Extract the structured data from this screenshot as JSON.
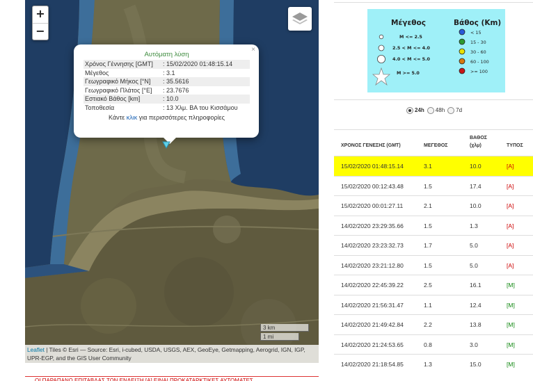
{
  "map": {
    "zoom_in": "+",
    "zoom_out": "−",
    "popup": {
      "title": "Αυτόματη λύση",
      "close": "×",
      "rows": [
        {
          "key": "Χρόνος Γέννησης [GMT]",
          "value": ": 15/02/2020 01:48:15.14"
        },
        {
          "key": "Μέγεθος",
          "value": ": 3.1"
        },
        {
          "key": "Γεωγραφικό Μήκος [°N]",
          "value": ": 35.5616"
        },
        {
          "key": "Γεωγραφικό Πλάτος [°E]",
          "value": ": 23.7676"
        },
        {
          "key": "Εστιακό Βάθος [km]",
          "value": ": 10.0"
        },
        {
          "key": "Τοποθεσία",
          "value": ": 13 Χλμ. ΒΑ του Κισσάμου"
        }
      ],
      "more_pre": "Κάντε ",
      "more_link": "κλικ",
      "more_post": " για περισσότερες πληροφορίες"
    },
    "scale": {
      "km": "3 km",
      "mi": "1 mi"
    },
    "attribution_link": "Leaflet",
    "attribution_text": " | Tiles © Esri — Source: Esri, i-cubed, USDA, USGS, AEX, GeoEye, Getmapping, Aerogrid, IGN, IGP, UPR-EGP, and the GIS User Community"
  },
  "notice": "ΟΙ ΠΑΡΑΠΑΝΩ ΕΠΙΤΑΒΛΑΣ ΤΩΝ ΕΝΔΕΙΞΗ [Α] ΕΙΝΑΙ ΠΡΟΚΑΤΑΡΚΤΙΚΕΣ ΑΥΤΟΜΑΤΕΣ",
  "legend": {
    "size_title": "Μέγεθος",
    "depth_title": "Βάθος (Km)",
    "sizes": [
      "M <= 2.5",
      "2.5 < M <= 4.0",
      "4.0 < M <= 5.0",
      "M >= 5.0"
    ],
    "depths": [
      {
        "label": "< 15",
        "color": "#2a5ad8"
      },
      {
        "label": "15 - 30",
        "color": "#2e9a2e"
      },
      {
        "label": "30 - 60",
        "color": "#e8e000"
      },
      {
        "label": "60 - 100",
        "color": "#d87a10"
      },
      {
        "label": ">= 100",
        "color": "#c81818"
      }
    ]
  },
  "filters": {
    "options": [
      "24h",
      "48h",
      "7d"
    ],
    "selected": "24h"
  },
  "table": {
    "headers": [
      "ΧΡΟΝΟΣ ΓΕΝΕΣΗΣ (GMT)",
      "ΜΕΓΕΘΟΣ",
      "ΒΑΘΟΣ",
      "(χλμ)",
      "ΤΥΠΟΣ"
    ],
    "rows": [
      {
        "time": "15/02/2020 01:48:15.14",
        "mag": "3.1",
        "depth": "10.0",
        "type": "[A]",
        "highlight": true
      },
      {
        "time": "15/02/2020 00:12:43.48",
        "mag": "1.5",
        "depth": "17.4",
        "type": "[A]"
      },
      {
        "time": "15/02/2020 00:01:27.11",
        "mag": "2.1",
        "depth": "10.0",
        "type": "[A]"
      },
      {
        "time": "14/02/2020 23:29:35.66",
        "mag": "1.5",
        "depth": "1.3",
        "type": "[A]"
      },
      {
        "time": "14/02/2020 23:23:32.73",
        "mag": "1.7",
        "depth": "5.0",
        "type": "[A]"
      },
      {
        "time": "14/02/2020 23:21:12.80",
        "mag": "1.5",
        "depth": "5.0",
        "type": "[A]"
      },
      {
        "time": "14/02/2020 22:45:39.22",
        "mag": "2.5",
        "depth": "16.1",
        "type": "[M]"
      },
      {
        "time": "14/02/2020 21:56:31.47",
        "mag": "1.1",
        "depth": "12.4",
        "type": "[M]"
      },
      {
        "time": "14/02/2020 21:49:42.84",
        "mag": "2.2",
        "depth": "13.8",
        "type": "[M]"
      },
      {
        "time": "14/02/2020 21:24:53.65",
        "mag": "0.8",
        "depth": "3.0",
        "type": "[M]"
      },
      {
        "time": "14/02/2020 21:18:54.85",
        "mag": "1.3",
        "depth": "15.0",
        "type": "[M]"
      }
    ]
  }
}
